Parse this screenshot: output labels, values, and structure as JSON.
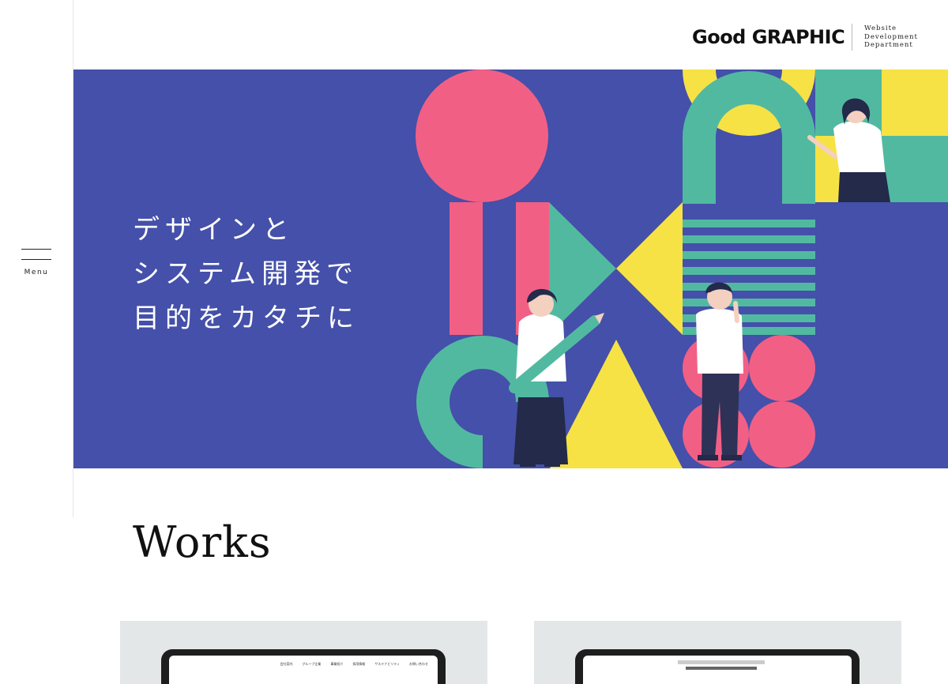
{
  "sidebar": {
    "menu_label": "Menu"
  },
  "header": {
    "logo": "Good GRAPHIC",
    "logo_sub": [
      "Website",
      "Development",
      "Department"
    ]
  },
  "hero": {
    "lines": [
      "デザインと",
      "システム開発で",
      "目的をカタチに"
    ],
    "colors": {
      "background": "#4450a9",
      "pink": "#f25f85",
      "green": "#52b9a1",
      "yellow": "#f7e245",
      "white": "#ffffff"
    }
  },
  "works": {
    "title": "Works",
    "cards": [
      {
        "nav": [
          "会社案内",
          "グループ企業",
          "事業紹介",
          "採用情報",
          "サステナビリティ",
          "お問い合わせ"
        ]
      },
      {
        "nav": []
      }
    ]
  }
}
